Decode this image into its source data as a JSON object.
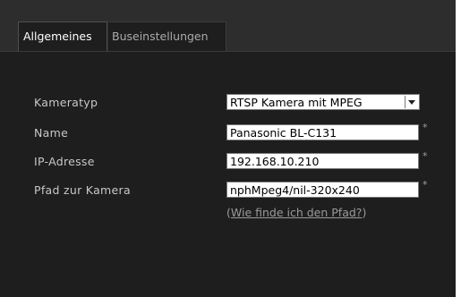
{
  "tabs": [
    {
      "label": "Allgemeines",
      "active": true
    },
    {
      "label": "Buseinstellungen",
      "active": false
    }
  ],
  "form": {
    "camera_type": {
      "label": "Kameratyp",
      "value": "RTSP Kamera mit MPEG"
    },
    "name": {
      "label": "Name",
      "value_prefix": "Panasonic ",
      "value_misspelled": "BL-C",
      "value_suffix": "131",
      "required_mark": "*"
    },
    "ip_address": {
      "label": "IP-Adresse",
      "value": "192.168.10.210",
      "required_mark": "*"
    },
    "camera_path": {
      "label": "Pfad zur Kamera",
      "value": "nphMpeg4/nil-320x240",
      "required_mark": "*"
    }
  },
  "help": {
    "open_paren": "(",
    "link_text": "Wie finde ich den Pfad?",
    "close_paren": ")"
  },
  "colors": {
    "background": "#1e1e1e",
    "tabbar": "#2d2d2d",
    "label_text": "#c8c8c8",
    "link_text": "#9a9a9a",
    "spellcheck_underline": "#d03030"
  },
  "icons": {
    "dropdown": "chevron-down-icon"
  }
}
